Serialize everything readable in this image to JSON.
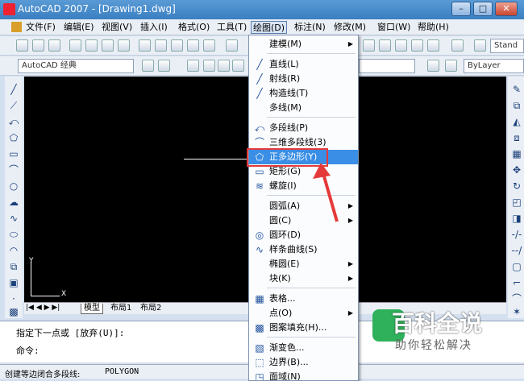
{
  "window": {
    "title": "AutoCAD 2007 - [Drawing1.dwg]",
    "minimize": "–",
    "maximize": "□",
    "close": "✕"
  },
  "menubar": {
    "items": [
      {
        "label": "文件(F)"
      },
      {
        "label": "编辑(E)"
      },
      {
        "label": "视图(V)"
      },
      {
        "label": "插入(I)"
      },
      {
        "label": "格式(O)"
      },
      {
        "label": "工具(T)"
      },
      {
        "label": "绘图(D)"
      },
      {
        "label": "标注(N)"
      },
      {
        "label": "修改(M)"
      },
      {
        "label": "窗口(W)"
      },
      {
        "label": "帮助(H)"
      }
    ]
  },
  "toolbar": {
    "workspace": "AutoCAD 经典",
    "bylayer": "ByLayer",
    "text_style": "Stand"
  },
  "dropdown": {
    "items": [
      {
        "label": "建模(M)",
        "icon": "",
        "submenu": true
      },
      {
        "label": "直线(L)",
        "icon": "╱"
      },
      {
        "label": "射线(R)",
        "icon": "╱"
      },
      {
        "label": "构造线(T)",
        "icon": "╱"
      },
      {
        "label": "多线(M)",
        "icon": ""
      },
      {
        "label": "多段线(P)",
        "icon": "⤺"
      },
      {
        "label": "三维多段线(3)",
        "icon": "⌒"
      },
      {
        "label": "正多边形(Y)",
        "icon": "⬠"
      },
      {
        "label": "矩形(G)",
        "icon": "▭"
      },
      {
        "label": "螺旋(I)",
        "icon": "≋"
      },
      {
        "label": "圆弧(A)",
        "icon": "",
        "submenu": true
      },
      {
        "label": "圆(C)",
        "icon": "",
        "submenu": true
      },
      {
        "label": "圆环(D)",
        "icon": "◎"
      },
      {
        "label": "样条曲线(S)",
        "icon": "∿"
      },
      {
        "label": "椭圆(E)",
        "icon": "",
        "submenu": true
      },
      {
        "label": "块(K)",
        "icon": "",
        "submenu": true
      },
      {
        "label": "表格...",
        "icon": "▦"
      },
      {
        "label": "点(O)",
        "icon": "",
        "submenu": true
      },
      {
        "label": "图案填充(H)...",
        "icon": "▩"
      },
      {
        "label": "渐变色...",
        "icon": "▧"
      },
      {
        "label": "边界(B)...",
        "icon": "⬚"
      },
      {
        "label": "面域(N)",
        "icon": "◳"
      }
    ]
  },
  "tabs": {
    "model": "模型",
    "layout1": "布局1",
    "layout2": "布局2"
  },
  "command": {
    "line1": "指定下一点或 [放弃(U)]:",
    "line2": "命令:"
  },
  "status": {
    "hint": "创建等边闭合多段线:",
    "command": "POLYGON"
  },
  "axes": {
    "x": "X",
    "y": "Y"
  },
  "watermark": {
    "title": "百科全说",
    "subtitle": "助你轻松解决"
  },
  "colors": {
    "highlight": "#3a8ee6",
    "annotation": "#e53a3a"
  }
}
